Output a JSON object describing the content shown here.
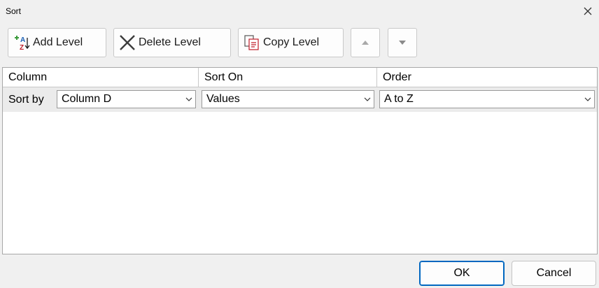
{
  "window": {
    "title": "Sort"
  },
  "toolbar": {
    "add_level": "Add Level",
    "delete_level": "Delete Level",
    "copy_level": "Copy Level"
  },
  "columns": {
    "column": "Column",
    "sort_on": "Sort On",
    "order": "Order"
  },
  "row": {
    "label": "Sort by",
    "column_value": "Column D",
    "sort_on_value": "Values",
    "order_value": "A to Z"
  },
  "footer": {
    "ok": "OK",
    "cancel": "Cancel"
  },
  "icons": {
    "add": "sort-az-add-icon",
    "delete": "x-delete-icon",
    "copy": "copy-icon",
    "up": "move-up-icon",
    "down": "move-down-icon",
    "close": "close-icon"
  },
  "colors": {
    "accent": "#0067c0",
    "selected_row": "#ebebeb"
  }
}
